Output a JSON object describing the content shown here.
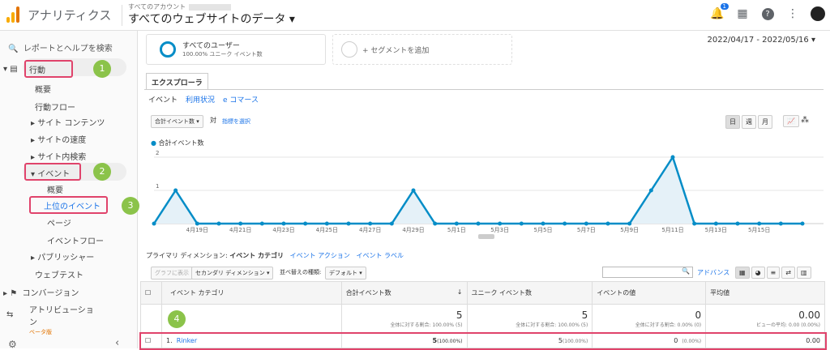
{
  "app": {
    "title": "アナリティクス",
    "account_label": "すべてのアカウント",
    "view_name": "すべてのウェブサイトのデータ ▾"
  },
  "topbar": {
    "notification_count": "1"
  },
  "sidebar": {
    "search": "レポートとヘルプを検索",
    "behavior": "行動",
    "overview": "概要",
    "behavior_flow": "行動フロー",
    "site_content": "サイト コンテンツ",
    "site_speed": "サイトの速度",
    "site_search": "サイト内検索",
    "events": "イベント",
    "events_overview": "概要",
    "top_events": "上位のイベント",
    "pages": "ページ",
    "events_flow": "イベントフロー",
    "publishers": "パブリッシャー",
    "experiments": "ウェブテスト",
    "conversions": "コンバージョン",
    "attribution": "アトリビューショ",
    "attribution_cont": "ン",
    "beta": "ベータ版",
    "collapse": "‹"
  },
  "annotations": [
    "1",
    "2",
    "3",
    "4"
  ],
  "segments": {
    "all_users": "すべてのユーザー",
    "all_users_sub": "100.00% ユニーク イベント数",
    "add": "+ セグメントを追加"
  },
  "date_range": "2022/04/17 - 2022/05/16",
  "explorer": {
    "tab": "エクスプローラ",
    "links": [
      "イベント",
      "利用状況",
      "e コマース"
    ]
  },
  "chart_controls": {
    "metric": "合計イベント数 ▾",
    "vs": "対",
    "select_metric": "指標を選択",
    "day": "日",
    "week": "週",
    "month": "月"
  },
  "chart_data": {
    "type": "area",
    "series": [
      {
        "name": "合計イベント数",
        "values": [
          0,
          1,
          0,
          0,
          0,
          0,
          0,
          0,
          0,
          0,
          0,
          0,
          1,
          0,
          0,
          0,
          0,
          0,
          0,
          0,
          0,
          0,
          0,
          1,
          2,
          0,
          0,
          0,
          0,
          0,
          0
        ]
      }
    ],
    "x_tick_labels": [
      "4月19日",
      "4月21日",
      "4月23日",
      "4月25日",
      "4月27日",
      "4月29日",
      "5月1日",
      "5月3日",
      "5月5日",
      "5月7日",
      "5月9日",
      "5月11日",
      "5月13日",
      "5月15日"
    ],
    "y_ticks": [
      "1",
      "2"
    ],
    "ylim": [
      0,
      2
    ],
    "color": "#058dc7"
  },
  "dimensions": {
    "label": "プライマリ ディメンション:",
    "active": "イベント カテゴリ",
    "action": "イベント アクション",
    "label2": "イベント ラベル"
  },
  "table_controls": {
    "plot": "グラフに表示",
    "secondary": "セカンダリ ディメンション ▾",
    "sort_label": "並べ替えの種類:",
    "sort_value": "デフォルト ▾",
    "advanced": "アドバンス"
  },
  "table": {
    "headers": [
      "イベント カテゴリ",
      "合計イベント数",
      "ユニーク イベント数",
      "イベントの値",
      "平均値"
    ],
    "totals": [
      "5",
      "5",
      "0",
      "0.00"
    ],
    "totals_sub": [
      "全体に対する割合: 100.00% (5)",
      "全体に対する割合: 100.00% (5)",
      "全体に対する割合: 0.00% (0)",
      "ビューの平均: 0.00 (0.00%)"
    ],
    "row": {
      "index": "1.",
      "name": "Rinker",
      "total": "5",
      "total_pct": "(100.00%)",
      "unique": "5",
      "unique_pct": "(100.00%)",
      "value": "0",
      "value_pct": "(0.00%)",
      "avg": "0.00"
    }
  }
}
